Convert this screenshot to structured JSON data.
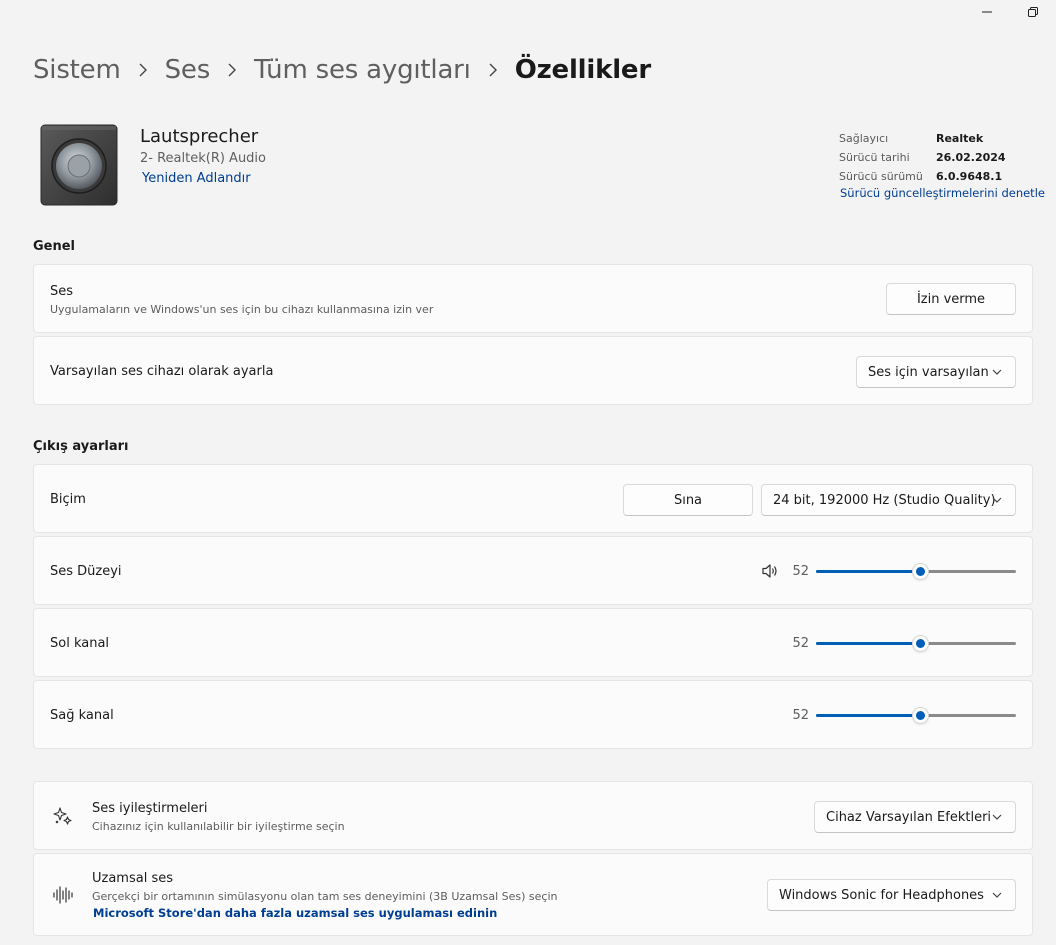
{
  "breadcrumb": [
    "Sistem",
    "Ses",
    "Tüm ses aygıtları",
    "Özellikler"
  ],
  "device": {
    "name": "Lautsprecher",
    "subtitle": "2- Realtek(R) Audio",
    "rename_link": "Yeniden Adlandır"
  },
  "driver_info": {
    "rows": [
      {
        "key": "Sağlayıcı",
        "value": "Realtek"
      },
      {
        "key": "Sürücü tarihi",
        "value": "26.02.2024"
      },
      {
        "key": "Sürücü sürümü",
        "value": "6.0.9648.1"
      }
    ],
    "link": "Sürücü güncelleştirmelerini denetle"
  },
  "general": {
    "title": "Genel",
    "audio": {
      "title": "Ses",
      "description": "Uygulamaların ve Windows'un ses için bu cihazı kullanmasına izin ver",
      "button": "İzin verme"
    },
    "default_device": {
      "title": "Varsayılan ses cihazı olarak ayarla",
      "selected": "Ses için varsayılan"
    }
  },
  "output": {
    "title": "Çıkış ayarları",
    "format": {
      "title": "Biçim",
      "test_button": "Sına",
      "selected": "24 bit, 192000 Hz (Studio Quality)"
    },
    "volume": {
      "title": "Ses Düzeyi",
      "value": "52",
      "level": 52
    },
    "left": {
      "title": "Sol kanal",
      "value": "52",
      "level": 52
    },
    "right": {
      "title": "Sağ kanal",
      "value": "52",
      "level": 52
    }
  },
  "enhancements": {
    "title": "Ses iyileştirmeleri",
    "description": "Cihazınız için kullanılabilir bir iyileştirme seçin",
    "selected": "Cihaz Varsayılan Efektleri"
  },
  "spatial": {
    "title": "Uzamsal ses",
    "description": "Gerçekçi bir ortamının simülasyonu olan tam ses deneyimini (3B Uzamsal Ses) seçin",
    "link": "Microsoft Store'dan daha fazla uzamsal ses uygulaması edinin",
    "selected": "Windows Sonic for Headphones"
  },
  "colors": {
    "accent": "#005fb8",
    "link": "#003e92",
    "background": "#f3f3f3",
    "card": "#fbfbfb"
  },
  "icons": {
    "minimize": "minimize-icon",
    "restore": "restore-icon",
    "breadcrumb_separator": "chevron-right-icon",
    "device": "speaker-device-icon",
    "dropdown": "chevron-down-icon",
    "volume": "speaker-volume-icon",
    "enhancements": "sparkle-enhancements-icon",
    "spatial": "spatial-audio-waveform-icon"
  }
}
